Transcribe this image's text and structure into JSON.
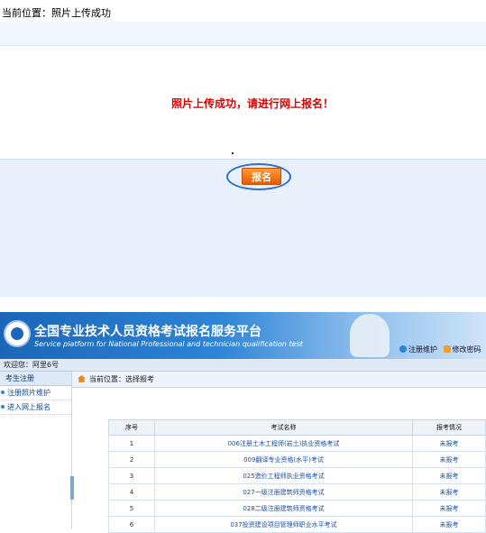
{
  "top": {
    "position_text": "当前位置：照片上传成功",
    "success_message": "照片上传成功，请进行网上报名！",
    "signup_button": "报名"
  },
  "banner": {
    "title": "全国专业技术人员资格考试报名服务平台",
    "subtitle": "Service platform for National Professional and technician qualification test",
    "link_account": "注册维护",
    "link_password": "修改密码"
  },
  "welcome": "欢迎您：阿里6号",
  "sidebar": {
    "header": "考生注册",
    "items": [
      {
        "label": "注册照片维护"
      },
      {
        "label": "进入网上报名"
      }
    ]
  },
  "main": {
    "position_text": "当前位置：选择报考"
  },
  "table": {
    "headers": [
      "序号",
      "考试名称",
      "报考情况"
    ],
    "rows": [
      {
        "no": "1",
        "name": "006注册土木工程师(岩土)执业资格考试",
        "status": "未报考"
      },
      {
        "no": "2",
        "name": "009翻译专业资格(水平)考试",
        "status": "未报考"
      },
      {
        "no": "3",
        "name": "025造价工程师执业资格考试",
        "status": "未报考"
      },
      {
        "no": "4",
        "name": "027一级注册建筑师资格考试",
        "status": "未报考"
      },
      {
        "no": "5",
        "name": "028二级注册建筑师资格考试",
        "status": "未报考"
      },
      {
        "no": "6",
        "name": "037投资建设项目管理师职业水平考试",
        "status": "未报考"
      }
    ]
  },
  "colors": {
    "success": "#e00000",
    "button": "#e55b00",
    "highlight_oval": "#2f6fd0",
    "banner": "#1b66b8"
  }
}
